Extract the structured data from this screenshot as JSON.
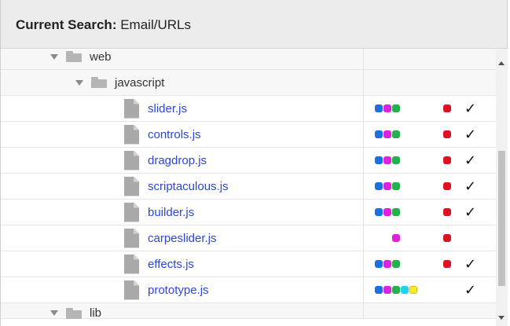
{
  "header": {
    "label": "Current Search:",
    "value": "Email/URLs"
  },
  "folders": {
    "web": "web",
    "javascript": "javascript",
    "lib": "lib"
  },
  "files": [
    {
      "name": "slider.js",
      "dots": [
        "blue",
        "magenta",
        "green"
      ],
      "red": true,
      "check": true
    },
    {
      "name": "controls.js",
      "dots": [
        "blue",
        "magenta",
        "green"
      ],
      "red": true,
      "check": true
    },
    {
      "name": "dragdrop.js",
      "dots": [
        "blue",
        "magenta",
        "green"
      ],
      "red": true,
      "check": true
    },
    {
      "name": "scriptaculous.js",
      "dots": [
        "blue",
        "magenta",
        "green"
      ],
      "red": true,
      "check": true
    },
    {
      "name": "builder.js",
      "dots": [
        "blue",
        "magenta",
        "green"
      ],
      "red": true,
      "check": true
    },
    {
      "name": "carpeslider.js",
      "dots": [
        "magenta"
      ],
      "red": true,
      "check": false
    },
    {
      "name": "effects.js",
      "dots": [
        "blue",
        "magenta",
        "green"
      ],
      "red": true,
      "check": true
    },
    {
      "name": "prototype.js",
      "dots": [
        "blue",
        "magenta",
        "green",
        "cyan",
        "yellow"
      ],
      "red": false,
      "check": true
    }
  ],
  "check_glyph": "✓",
  "colors": {
    "blue": "#1a6fe3",
    "magenta": "#dd22dd",
    "green": "#22b14c",
    "cyan": "#22d3e8",
    "yellow": "#f4ee2a",
    "red": "#dd1122",
    "link": "#2b47d6"
  }
}
